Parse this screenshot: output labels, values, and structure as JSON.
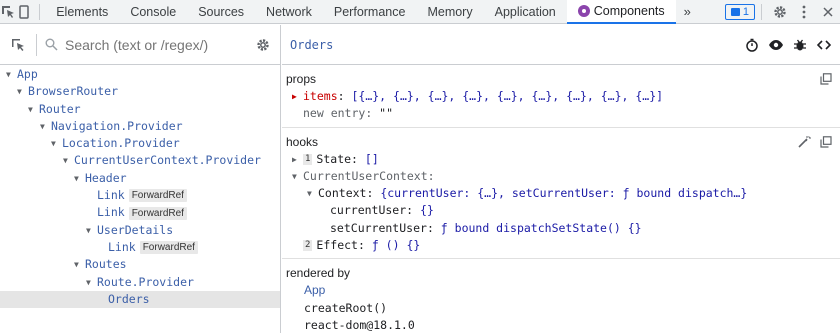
{
  "devtools_tabs": {
    "elements": "Elements",
    "console": "Console",
    "sources": "Sources",
    "network": "Network",
    "performance": "Performance",
    "memory": "Memory",
    "application": "Application",
    "components": "Components",
    "more": "»",
    "issues_count": "1"
  },
  "search": {
    "placeholder": "Search (text or /regex/)"
  },
  "tree": [
    {
      "label": "App",
      "arrow": "▼",
      "badge": ""
    },
    {
      "label": "BrowserRouter",
      "arrow": "▼",
      "badge": ""
    },
    {
      "label": "Router",
      "arrow": "▼",
      "badge": ""
    },
    {
      "label": "Navigation.Provider",
      "arrow": "▼",
      "badge": ""
    },
    {
      "label": "Location.Provider",
      "arrow": "▼",
      "badge": ""
    },
    {
      "label": "CurrentUserContext.Provider",
      "arrow": "▼",
      "badge": ""
    },
    {
      "label": "Header",
      "arrow": "▼",
      "badge": ""
    },
    {
      "label": "Link",
      "arrow": "",
      "badge": "ForwardRef"
    },
    {
      "label": "Link",
      "arrow": "",
      "badge": "ForwardRef"
    },
    {
      "label": "UserDetails",
      "arrow": "▼",
      "badge": ""
    },
    {
      "label": "Link",
      "arrow": "",
      "badge": "ForwardRef"
    },
    {
      "label": "Routes",
      "arrow": "▼",
      "badge": ""
    },
    {
      "label": "Route.Provider",
      "arrow": "▼",
      "badge": ""
    },
    {
      "label": "Orders",
      "arrow": "",
      "badge": ""
    }
  ],
  "inspector": {
    "selected_component": "Orders",
    "props_title": "props",
    "props_items_key": "items",
    "props_items_value": "[{…}, {…}, {…}, {…}, {…}, {…}, {…}, {…}, {…}]",
    "new_entry_key": "new entry",
    "new_entry_value": "\"\"",
    "hooks_title": "hooks",
    "hook1_index": "1",
    "hook1_key": "State",
    "hook1_value": "[]",
    "ctx_key": "CurrentUserContext",
    "context_key": "Context",
    "context_value": "{currentUser: {…}, setCurrentUser: ƒ bound dispatch…}",
    "current_user_key": "currentUser",
    "current_user_value": "{}",
    "set_current_user_key": "setCurrentUser",
    "set_current_user_value": "ƒ bound dispatchSetState() {}",
    "hook2_index": "2",
    "hook2_key": "Effect",
    "hook2_value": "ƒ () {}",
    "rendered_by_title": "rendered by",
    "rendered_by": [
      "App",
      "createRoot()",
      "react-dom@18.1.0"
    ]
  },
  "colors": {
    "accent": "#1a73e8",
    "component_name": "#3b5fa8",
    "prop_key": "#c80000",
    "value": "#1a1aa6"
  }
}
